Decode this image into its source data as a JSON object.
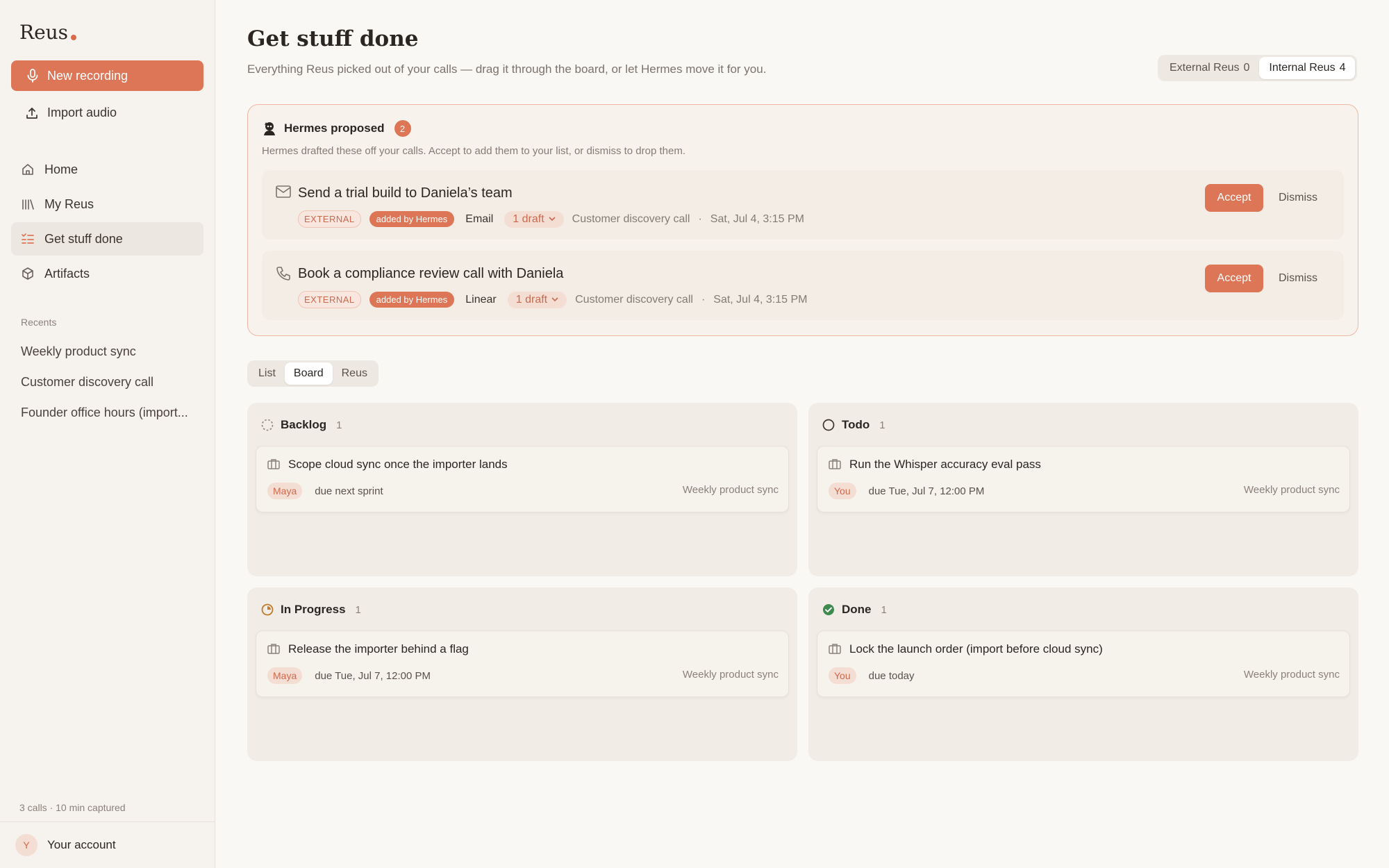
{
  "sidebar": {
    "brand": "Reus",
    "new_recording": "New recording",
    "import_audio": "Import audio",
    "nav": [
      {
        "label": "Home",
        "icon": "home-icon"
      },
      {
        "label": "My Reus",
        "icon": "library-icon"
      },
      {
        "label": "Get stuff done",
        "icon": "checklist-icon",
        "active": true
      },
      {
        "label": "Artifacts",
        "icon": "box-icon"
      }
    ],
    "recents_label": "Recents",
    "recents": [
      "Weekly product sync",
      "Customer discovery call",
      "Founder office hours (import..."
    ],
    "calls_meta": "3 calls · 10 min captured",
    "account_initial": "Y",
    "account_label": "Your account"
  },
  "header": {
    "title": "Get stuff done",
    "subtitle": "Everything Reus picked out of your calls — drag it through the board, or let Hermes move it for you.",
    "scope": [
      {
        "label": "External Reus",
        "count": "0"
      },
      {
        "label": "Internal Reus",
        "count": "4",
        "active": true
      }
    ]
  },
  "proposed": {
    "title": "Hermes proposed",
    "count": "2",
    "description": "Hermes drafted these off your calls. Accept to add them to your list, or dismiss to drop them.",
    "items": [
      {
        "icon": "mail-icon",
        "title": "Send a trial build to Daniela’s team",
        "scope_tag": "EXTERNAL",
        "added_tag": "added by Hermes",
        "channel": "Email",
        "drafts": "1 draft",
        "source": "Customer discovery call",
        "date": "Sat, Jul 4, 3:15 PM",
        "accept": "Accept",
        "dismiss": "Dismiss"
      },
      {
        "icon": "phone-icon",
        "title": "Book a compliance review call with Daniela",
        "scope_tag": "EXTERNAL",
        "added_tag": "added by Hermes",
        "channel": "Linear",
        "drafts": "1 draft",
        "source": "Customer discovery call",
        "date": "Sat, Jul 4, 3:15 PM",
        "accept": "Accept",
        "dismiss": "Dismiss"
      }
    ]
  },
  "view_tabs": [
    "List",
    "Board",
    "Reus"
  ],
  "active_view": "Board",
  "columns": [
    {
      "name": "Backlog",
      "count": "1",
      "icon": "backlog-icon",
      "task": {
        "title": "Scope cloud sync once the importer lands",
        "owner": "Maya",
        "due": "due next sprint",
        "source": "Weekly product sync"
      }
    },
    {
      "name": "Todo",
      "count": "1",
      "icon": "todo-circle-icon",
      "task": {
        "title": "Run the Whisper accuracy eval pass",
        "owner": "You",
        "due": "due Tue, Jul 7, 12:00 PM",
        "source": "Weekly product sync"
      }
    },
    {
      "name": "In Progress",
      "count": "1",
      "icon": "in-progress-icon",
      "task": {
        "title": "Release the importer behind a flag",
        "owner": "Maya",
        "due": "due Tue, Jul 7, 12:00 PM",
        "source": "Weekly product sync"
      }
    },
    {
      "name": "Done",
      "count": "1",
      "icon": "done-check-icon",
      "task": {
        "title": "Lock the launch order (import before cloud sync)",
        "owner": "You",
        "due": "due today",
        "source": "Weekly product sync"
      }
    }
  ],
  "colors": {
    "accent": "#dd7656",
    "background": "#faf8f4",
    "sidebar": "#f6f3ee",
    "done_green": "#3f8a4e",
    "in_progress_amber": "#c07a2a"
  }
}
